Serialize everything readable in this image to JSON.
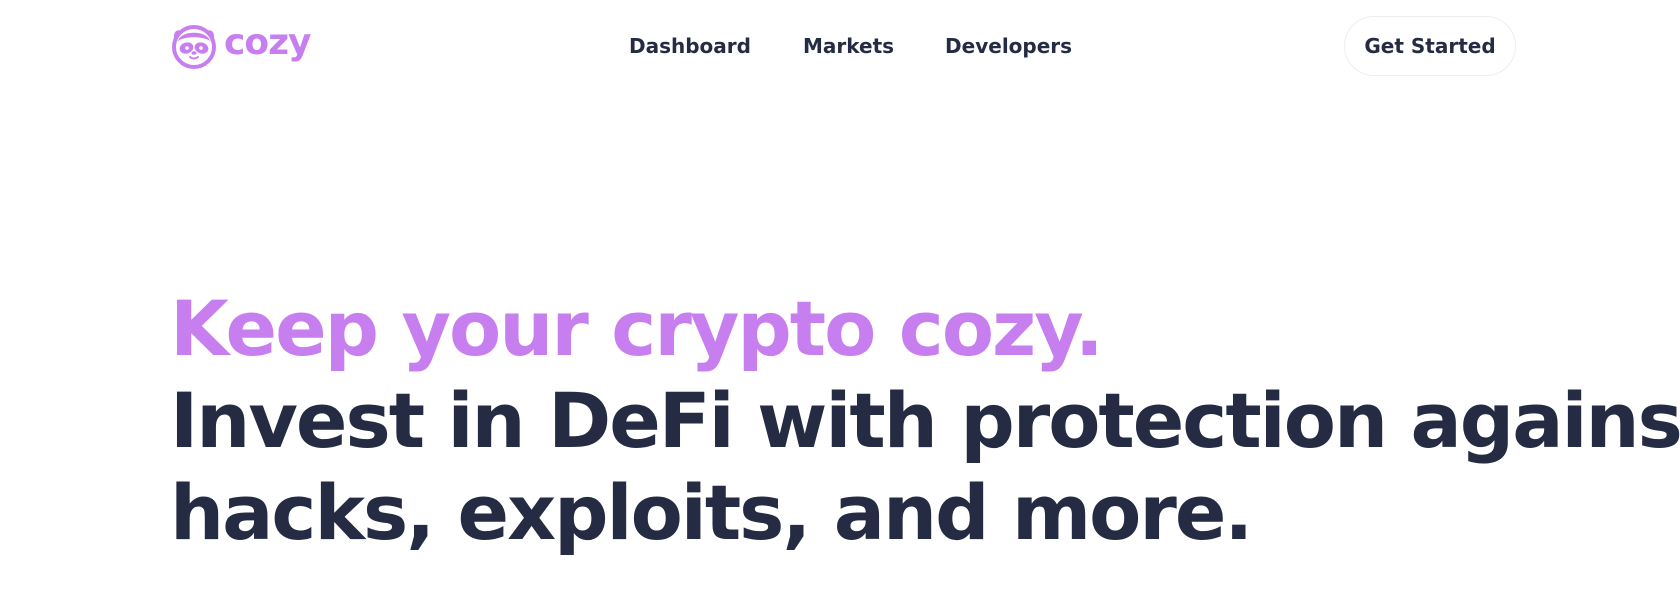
{
  "brand": {
    "name": "cozy",
    "logo_icon": "sloth-face-icon",
    "accent_color": "#c77ff0",
    "text_color": "#252b42"
  },
  "nav": {
    "items": [
      {
        "label": "Dashboard"
      },
      {
        "label": "Markets"
      },
      {
        "label": "Developers"
      }
    ]
  },
  "cta": {
    "label": "Get Started"
  },
  "hero": {
    "tagline": "Keep your crypto cozy.",
    "headline_line1": "Invest in DeFi with protection against",
    "headline_line2": "hacks, exploits, and more."
  }
}
